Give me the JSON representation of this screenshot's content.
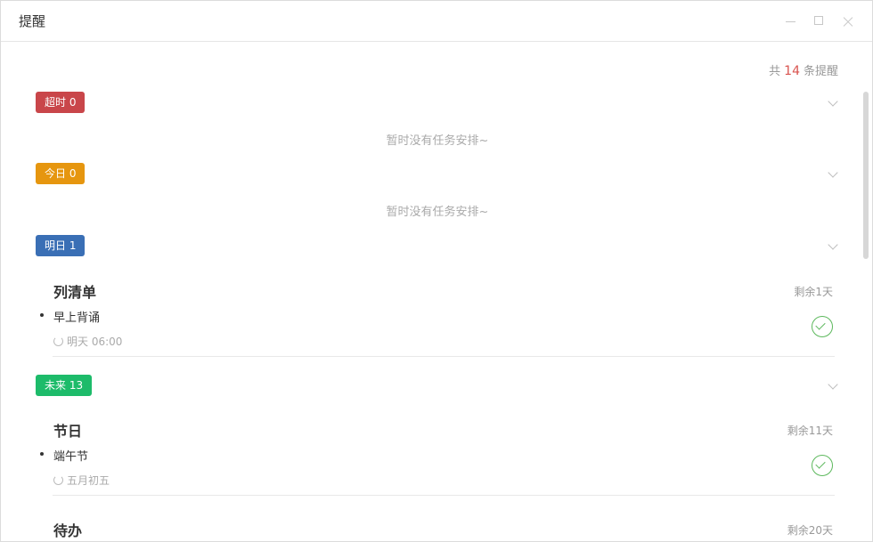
{
  "window": {
    "title": "提醒"
  },
  "summary": {
    "prefix": "共",
    "count": "14",
    "suffix": "条提醒"
  },
  "groups": {
    "overdue": {
      "label": "超时 0",
      "color": "#c9464a",
      "empty_text": "暂时没有任务安排~"
    },
    "today": {
      "label": "今日 0",
      "color": "#e6960f",
      "empty_text": "暂时没有任务安排~"
    },
    "tomorrow": {
      "label": "明日 1",
      "color": "#3a6fb5"
    },
    "future": {
      "label": "未来 13",
      "color": "#1dbb6a"
    }
  },
  "cards": [
    {
      "title": "列清单",
      "remaining": "剩余1天",
      "item": "早上背诵",
      "time": "明天 06:00"
    },
    {
      "title": "节日",
      "remaining": "剩余11天",
      "item": "端午节",
      "time": "五月初五"
    },
    {
      "title": "待办",
      "remaining": "剩余20天"
    }
  ],
  "icons": [
    "minimize-icon",
    "maximize-icon",
    "close-icon",
    "chevron-down-icon",
    "repeat-icon",
    "check-circle-icon"
  ]
}
